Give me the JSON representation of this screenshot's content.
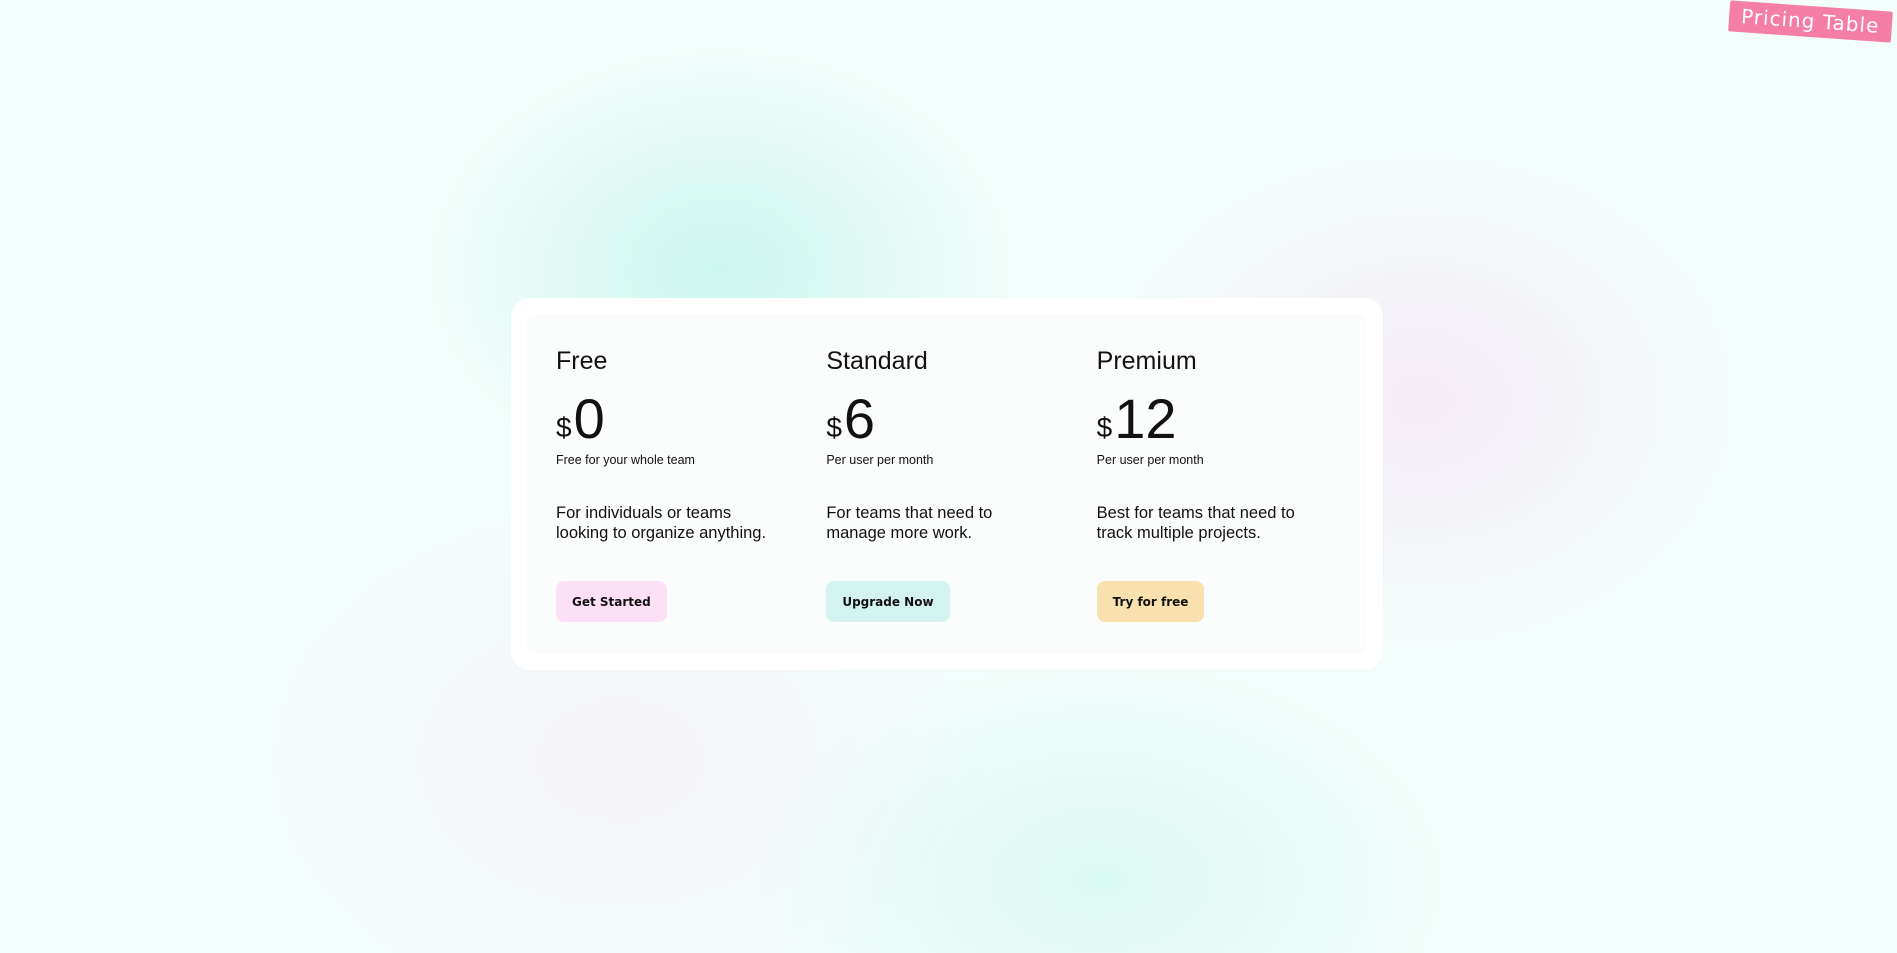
{
  "corner_badge": "Pricing Table",
  "plans": [
    {
      "name": "Free",
      "currency": "$",
      "amount": "0",
      "price_note": "Free for your whole team",
      "description": "For individuals or teams looking to organize anything.",
      "cta_label": "Get Started",
      "cta_color": "#fde0f6"
    },
    {
      "name": "Standard",
      "currency": "$",
      "amount": "6",
      "price_note": "Per user per month",
      "description": "For teams that need to manage more work.",
      "cta_label": "Upgrade Now",
      "cta_color": "#d3f3f1"
    },
    {
      "name": "Premium",
      "currency": "$",
      "amount": "12",
      "price_note": "Per user per month",
      "description": "Best for teams that need to track multiple projects.",
      "cta_label": "Try for free",
      "cta_color": "#f8e0af"
    }
  ],
  "colors": {
    "badge": "#f47ea5",
    "background": "#f3fdfb",
    "panel": "#ffffff"
  }
}
